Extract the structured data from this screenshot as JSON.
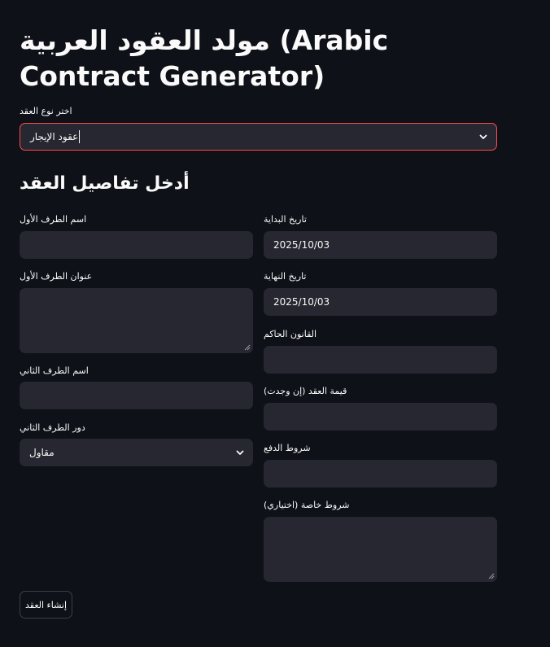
{
  "header": {
    "title": "مولد العقود العربية (Arabic Contract Generator)"
  },
  "contract_type": {
    "label": "اختر نوع العقد",
    "value": "عقود الإيجار"
  },
  "details": {
    "heading": "أدخل تفاصيل العقد"
  },
  "left_column": {
    "party1_name_label": "اسم الطرف الأول",
    "party1_name_value": "",
    "party1_address_label": "عنوان الطرف الأول",
    "party1_address_value": "",
    "party2_name_label": "اسم الطرف الثاني",
    "party2_name_value": "",
    "party2_role_label": "دور الطرف الثاني",
    "party2_role_value": "مقاول"
  },
  "right_column": {
    "start_date_label": "تاريخ البداية",
    "start_date_value": "2025/10/03",
    "end_date_label": "تاريخ النهاية",
    "end_date_value": "2025/10/03",
    "governing_law_label": "القانون الحاكم",
    "governing_law_value": "",
    "contract_value_label": "قيمة العقد (إن وجدت)",
    "contract_value_value": "",
    "payment_terms_label": "شروط الدفع",
    "payment_terms_value": "",
    "special_terms_label": "شروط خاصة (اختياري)",
    "special_terms_value": ""
  },
  "actions": {
    "generate_label": "إنشاء العقد"
  },
  "colors": {
    "background": "#0e1117",
    "field": "#262730",
    "focus_border": "#ff4b4b",
    "text": "#fafafa"
  },
  "icons": {
    "dropdown": "chevron-down-icon",
    "resize": "resize-handle-icon"
  }
}
